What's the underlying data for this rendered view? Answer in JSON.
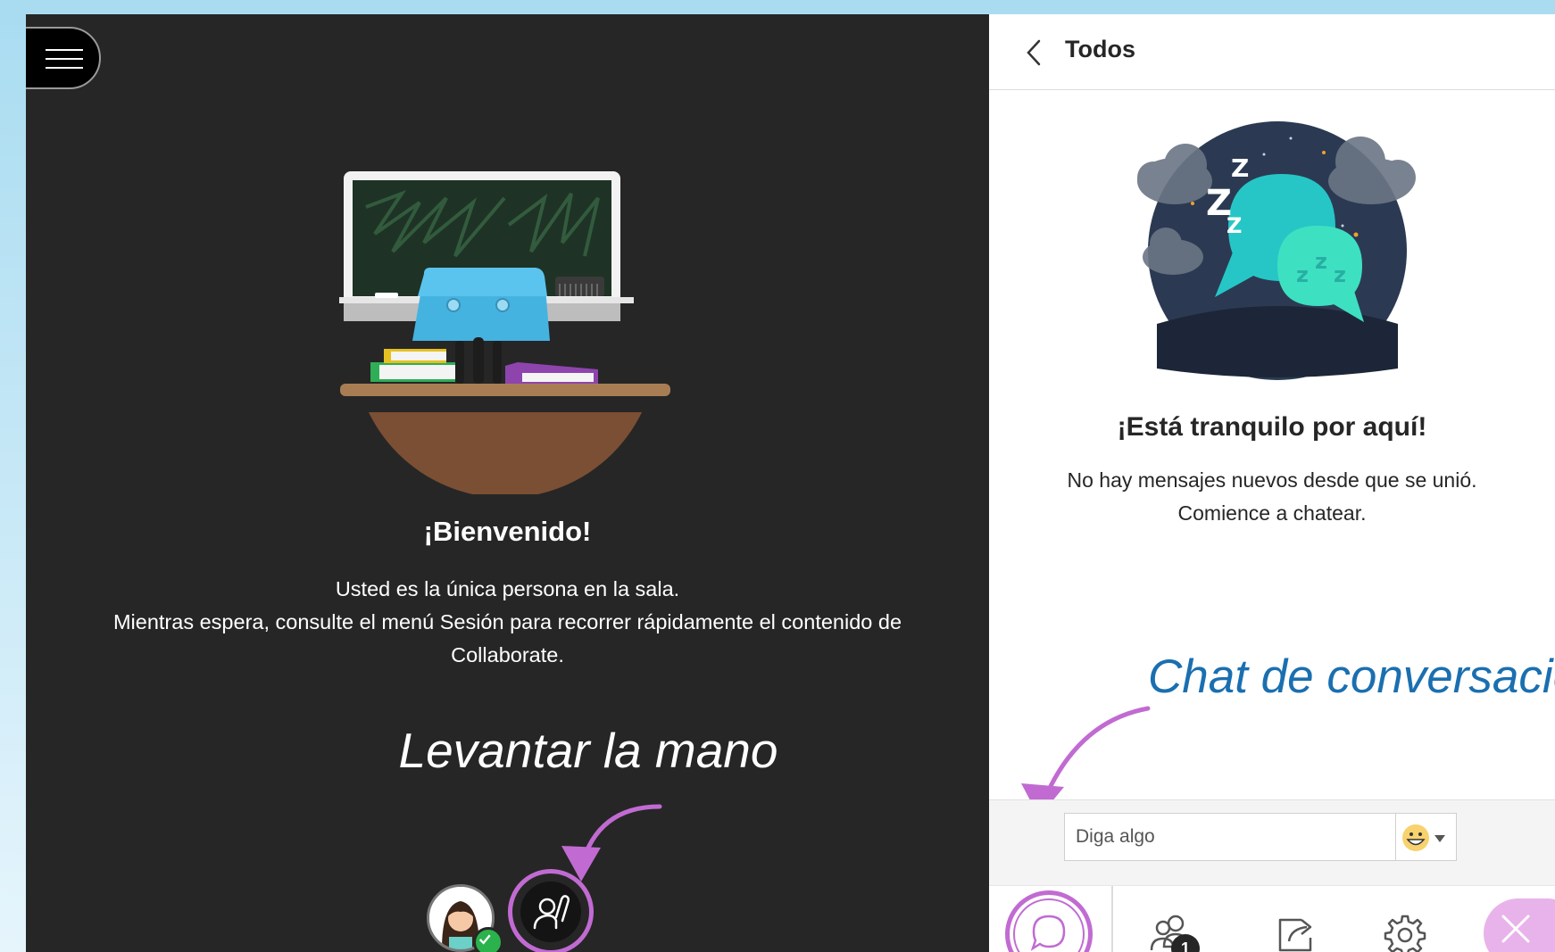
{
  "room": {
    "menu_label": "Menú",
    "welcome_title": "¡Bienvenido!",
    "welcome_line1": "Usted es la única persona en la sala.",
    "welcome_line2": "Mientras espera, consulte el menú Sesión para recorrer rápidamente el contenido de Collaborate.",
    "annotation_raise_hand": "Levantar la mano"
  },
  "panel": {
    "title": "Todos",
    "empty_title": "¡Está tranquilo por aquí!",
    "empty_line1": "No hay mensajes nuevos desde que se unió.",
    "empty_line2": "Comience a chatear.",
    "annotation_chat": "Chat de conversación",
    "input_placeholder": "Diga algo",
    "attendee_count": "1"
  },
  "colors": {
    "room_bg": "#262626",
    "annotation_highlight": "#c16bd2",
    "chat_annotation": "#1a6fb0",
    "online_status": "#2bb24c",
    "close_button": "#e8b3ea"
  },
  "icons": [
    "menu-icon",
    "chevron-left-icon",
    "emoji-icon",
    "caret-down-icon",
    "chat-icon",
    "attendees-icon",
    "share-icon",
    "gear-icon",
    "close-icon",
    "raise-hand-icon"
  ]
}
